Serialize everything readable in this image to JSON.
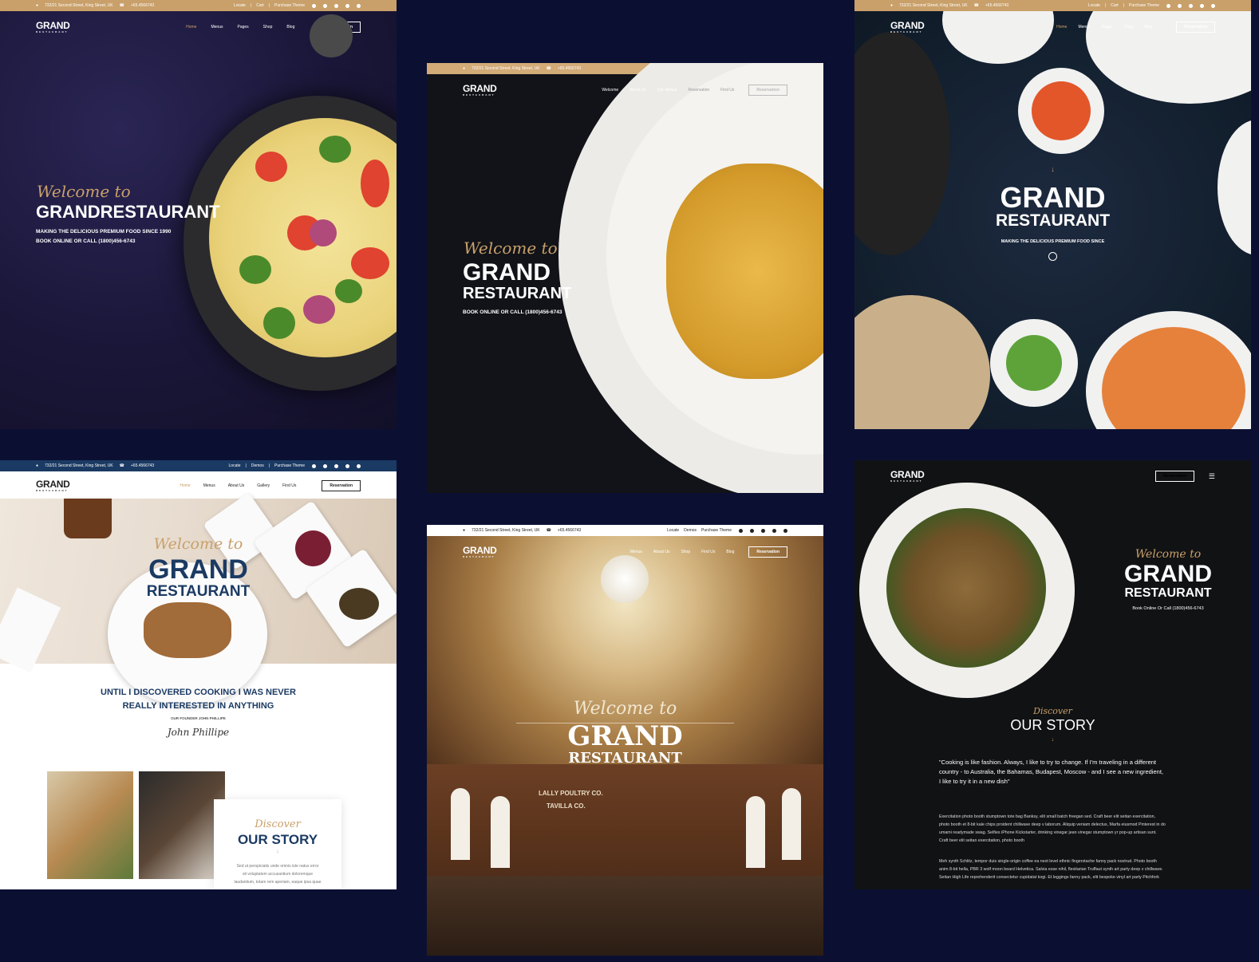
{
  "topbar": {
    "address": "732/21 Second Street, King Street, UK",
    "phone": "+65.4566743",
    "link_locate": "Locate",
    "link_cart": "Cart",
    "link_demos": "Demos",
    "link_purchase": "Purchase Theme"
  },
  "logo": {
    "main": "GRAND",
    "sub": "RESTAURANT"
  },
  "nav": {
    "home": "Home",
    "menus": "Menus",
    "pages": "Pages",
    "shop": "Shop",
    "blog": "Blog",
    "welcome": "Welcome",
    "about": "About Us",
    "our_menus": "Our Menus",
    "reservation_link": "Reservation",
    "find_us": "Find Us",
    "gallery": "Gallery",
    "reservation_btn": "Reservation"
  },
  "panel1": {
    "welcome": "Welcome to",
    "title": "GRANDRESTAURANT",
    "line1": "MAKING THE DELICIOUS PREMIUM FOOD SINCE 1990",
    "line2": "BOOK ONLINE OR CALL (1800)456-6743"
  },
  "panel2": {
    "welcome": "Welcome to",
    "title1": "GRAND",
    "title2": "RESTAURANT",
    "line": "BOOK ONLINE OR CALL (1800)456-6743"
  },
  "panel3": {
    "title1": "GRAND",
    "title2": "RESTAURANT",
    "line": "MAKING THE DELICIOUS PREMIUM FOOD SINCE"
  },
  "panel4": {
    "welcome": "Welcome to",
    "title1": "GRAND",
    "title2": "RESTAURANT",
    "quote1": "UNTIL I DISCOVERED COOKING I WAS NEVER",
    "quote2": "REALLY INTERESTED IN ANYTHING",
    "founder": "OUR FOUNDER JOHN PHILLIPE",
    "signature": "John Phillipe",
    "discover": "Discover",
    "story": "OUR STORY",
    "story_text1": "Sed ut perspiciatis unde omnis iste natus error",
    "story_text2": "sit voluptatem accusantium doloremque",
    "story_text3": "laudantium, totam rem aperiam, eaque ipsa quae"
  },
  "panel5": {
    "welcome": "Welcome to",
    "title1": "GRAND",
    "title2": "RESTAURANT",
    "sign1": "LALLY POULTRY CO.",
    "sign2": "TAVILLA CO."
  },
  "panel6": {
    "reservation": "Reservation",
    "welcome": "Welcome to",
    "title1": "GRAND",
    "title2": "RESTAURANT",
    "book": "Book Online Or Call (1800)456-6743",
    "discover": "Discover",
    "story": "OUR STORY",
    "quote": "\"Cooking is like fashion. Always, I like to try to change. If I'm traveling in a different country - to Australia, the Bahamas, Budapest, Moscow - and I see a new ingredient, I like to try it in a new dish\"",
    "para1": "Exercitation photo booth stumptown tote bag Banksy, elit small batch freegan sed. Craft beer elit seitan exercitation, photo booth et 8-bit kale chips proident chillwave deep v laborum. Aliquip veniam delectus, Marfa eiusmod Pinterest in do umami readymade swag. Selfies iPhone Kickstarter, drinking vinegar jean vinegar stumptown yr pop-up artisan sunt. Craft beer elit seitan exercitation, photo booth",
    "para2": "Meh synth Schlitz, tempor duis single-origin coffee ea next level ethnic fingerstache fanny pack nostrud. Photo booth anim 8-bit hella, PBR 3 wolf moon beard Helvetica. Salvia esse nihil, flexitarian Truffaut synth art party deep v chillwave. Seitan High Life reprehenderit consectetur cupidatat kogi. Et leggings fanny pack, elit bespoke vinyl art party Pitchfork"
  },
  "colors": {
    "background": "#0b1033",
    "gold": "#c9a06a",
    "navy": "#1b3a63"
  }
}
